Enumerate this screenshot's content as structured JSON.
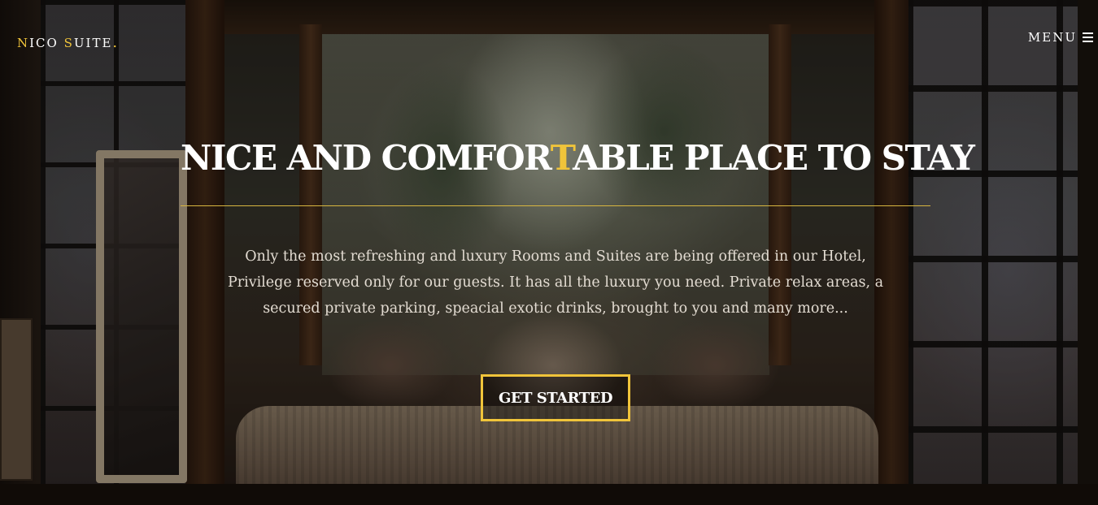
{
  "brand": {
    "part1_first": "N",
    "part1_rest": "ICO ",
    "part2_first": "S",
    "part2_rest": "UITE",
    "dot": ".",
    "accent_color": "#f0c43a"
  },
  "nav": {
    "menu_label": "MENU",
    "menu_icon": "hamburger-icon"
  },
  "hero": {
    "title_before": "NICE AND COMFOR",
    "title_accent": "T",
    "title_after": "ABLE PLACE TO STAY",
    "description": "Only the most refreshing and luxury Rooms and Suites are being offered in our Hotel, Privilege reserved only for our guests. It has all the luxury you need. Private relax areas, a secured private parking, speacial exotic drinks, brought to you and many more...",
    "cta_label": "GET STARTED"
  },
  "colors": {
    "accent": "#f0c43a",
    "text": "#ffffff",
    "body_text": "#e3dcd2"
  }
}
